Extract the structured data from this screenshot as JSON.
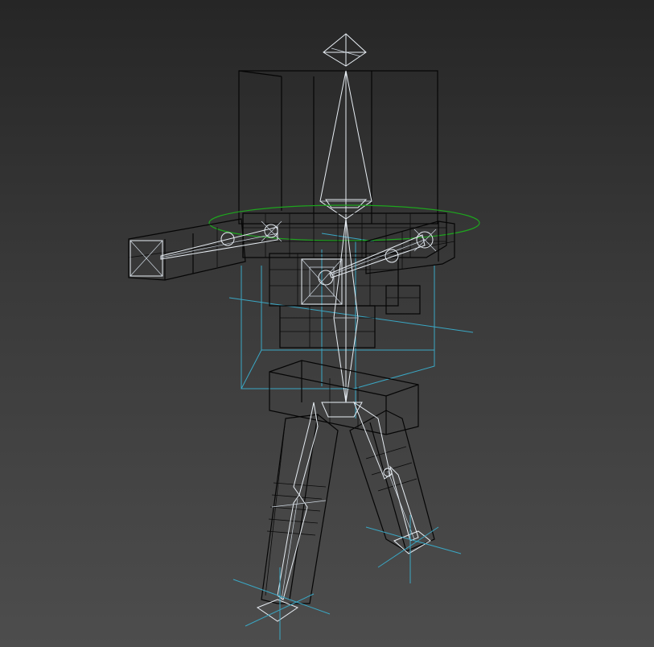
{
  "viewport": {
    "mode": "wireframe",
    "background_top": "#262626",
    "background_bottom": "#4d4d4d"
  },
  "colors": {
    "mesh": "#050505",
    "bone": "#e8eef4",
    "biped_cyan": "#3aa7c4",
    "selection_ring_green": "#1ea51e"
  },
  "scene_objects": [
    "head-box",
    "torso-mesh",
    "pelvis-mesh",
    "left-arm",
    "right-arm",
    "left-leg",
    "right-leg",
    "spine-bone",
    "neck-bone",
    "head-bone",
    "com-ring",
    "foot-gizmos"
  ]
}
